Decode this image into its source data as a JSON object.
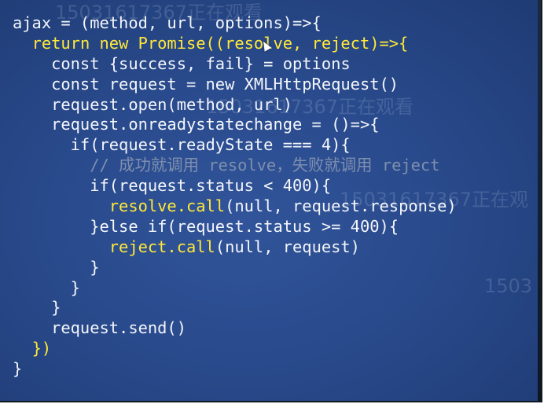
{
  "watermarks": {
    "w1": "15031617367正在观看",
    "w2": "15031617367正在观看",
    "w3": "15031617367正在观",
    "w4": "1503"
  },
  "code": {
    "l1": "ajax = (method, url, options)=>{",
    "l2_indent": "  ",
    "l2": "return new Promise((resolve, reject)=>{",
    "l3": "    const {success, fail} = options",
    "l4": "    const request = new XMLHttpRequest()",
    "l5": "    request.open(method, url)",
    "l6": "    request.onreadystatechange = ()=>{",
    "l7": "      if(request.readyState === 4){",
    "l8_indent": "        ",
    "l8": "// 成功就调用 resolve，失败就调用 reject",
    "l9": "        if(request.status < 400){",
    "l10_indent": "          ",
    "l10_kw": "resolve.call",
    "l10_rest": "(null, request.response)",
    "l11": "        }else if(request.status >= 400){",
    "l12_indent": "          ",
    "l12_kw": "reject.call",
    "l12_rest": "(null, request)",
    "l13": "        }",
    "l14": "      }",
    "l15": "    }",
    "l16": "    request.send()",
    "l17_indent": "  ",
    "l17": "})",
    "l18": "}"
  },
  "colors": {
    "background": "#294a8c",
    "code_text": "#f4f6fb",
    "keyword_highlight": "#ffe83a",
    "comment": "#7e8fae"
  },
  "icons": {
    "cursor": "mouse-pointer-icon"
  }
}
